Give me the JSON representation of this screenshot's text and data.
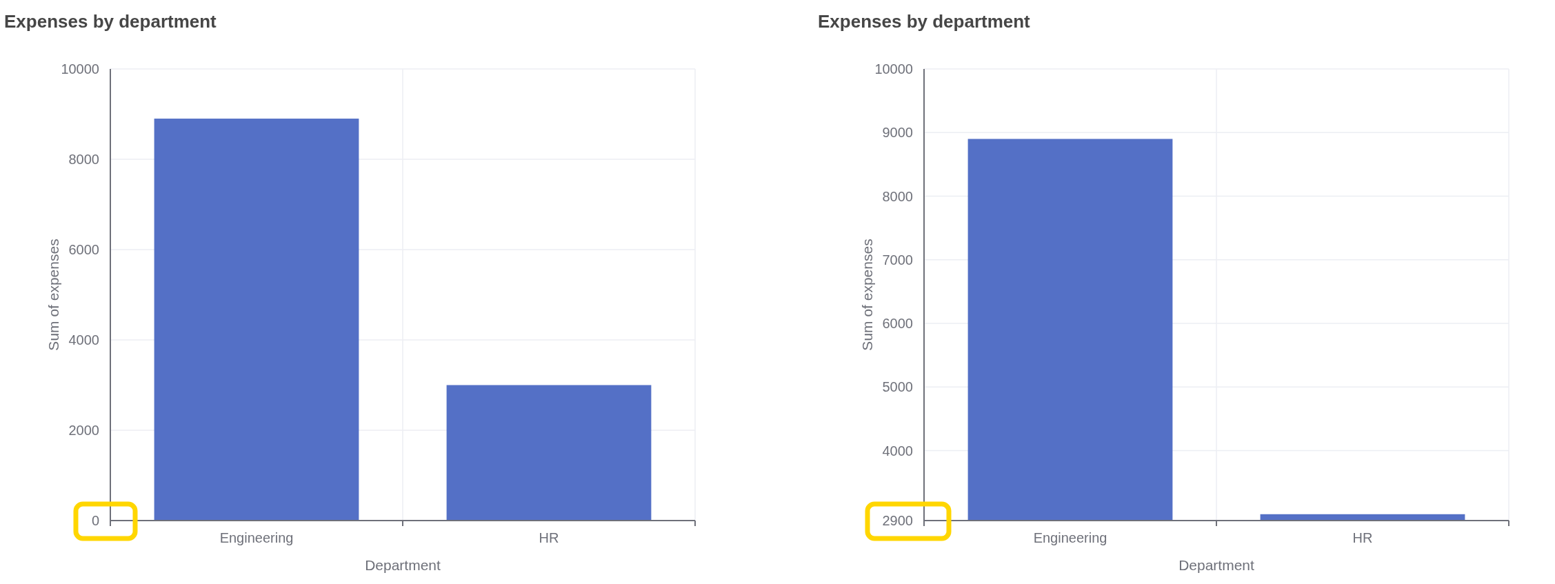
{
  "charts": [
    {
      "title": "Expenses by department",
      "tick_highlight": true,
      "chart_data": {
        "type": "bar",
        "xlabel": "Department",
        "ylabel": "Sum of expenses",
        "categories": [
          "Engineering",
          "HR"
        ],
        "series": [
          {
            "color": "#5470c6",
            "values": [
              8900,
              3000
            ]
          }
        ],
        "ylim": [
          0,
          10000
        ],
        "yticks": [
          0,
          2000,
          4000,
          6000,
          8000,
          10000
        ],
        "grid": true
      }
    },
    {
      "title": "Expenses by department",
      "tick_highlight": true,
      "chart_data": {
        "type": "bar",
        "xlabel": "Department",
        "ylabel": "Sum of expenses",
        "categories": [
          "Engineering",
          "HR"
        ],
        "series": [
          {
            "color": "#5470c6",
            "values": [
              8900,
              3000
            ]
          }
        ],
        "ylim": [
          2900,
          10000
        ],
        "yticks": [
          2900,
          4000,
          5000,
          6000,
          7000,
          8000,
          9000,
          10000
        ],
        "grid": true
      }
    }
  ]
}
